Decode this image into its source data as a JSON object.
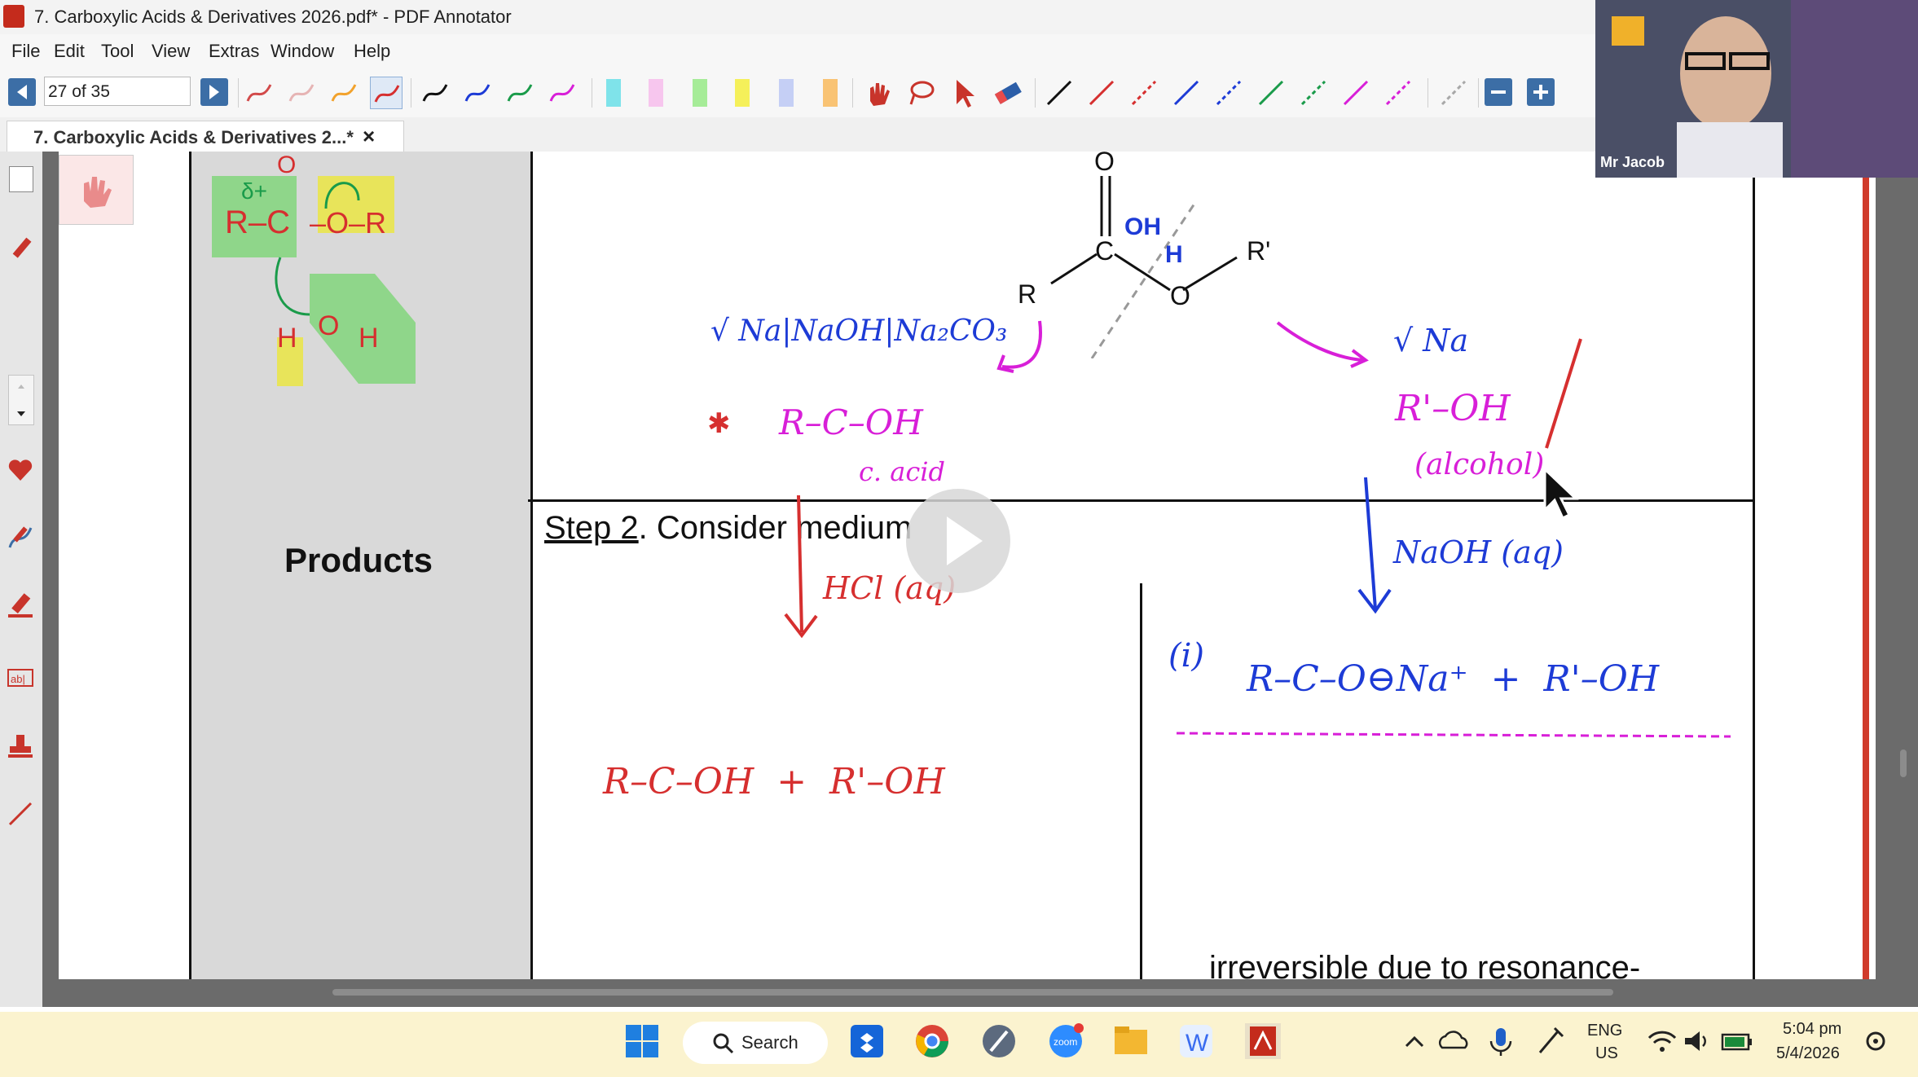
{
  "window": {
    "title": "7. Carboxylic Acids & Derivatives 2026.pdf* - PDF Annotator"
  },
  "menu": [
    "File",
    "Edit",
    "Tool",
    "View",
    "Extras",
    "Window",
    "Help"
  ],
  "toolbar": {
    "page_indicator": "27 of 35"
  },
  "tab": {
    "label": "7. Carboxylic Acids & Derivatives 2...*",
    "close": "×"
  },
  "document": {
    "products_label": "Products",
    "step2_underlined": "Step 2",
    "step2_rest": ". Consider medium",
    "irreversible_text": "irreversible due to resonance-",
    "handwriting": {
      "reagents_left": "√ Na|NaOH|Na₂CO₃",
      "acid_formula": "R–C–OH",
      "acid_note": "c. acid",
      "reagent_right": "√ Na",
      "alcohol_formula": "R'–OH",
      "alcohol_note": "(alcohol)",
      "acid_medium": "HCl (aq)",
      "base_medium": "NaOH (aq)",
      "acid_products": "R–C–OH  +  R'–OH",
      "base_label": "(i)",
      "base_products": "R–C–O⊖Na⁺  +  R'–OH",
      "ester_label_r": "R",
      "ester_label_o": "O",
      "ester_label_rprime": "R'",
      "ester_label_c": "C",
      "ester_label_top_o": "O",
      "oh_mark": "OH",
      "h_mark": "H"
    }
  },
  "webcam": {
    "name": "Mr Jacob"
  },
  "taskbar": {
    "search_label": "Search",
    "language_top": "ENG",
    "language_bottom": "US",
    "time": "5:04 pm",
    "date": "5/4/2026"
  }
}
